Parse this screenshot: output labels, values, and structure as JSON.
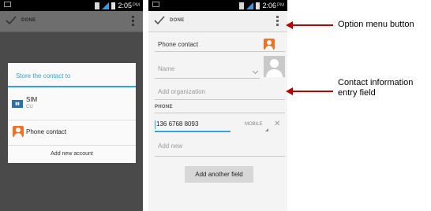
{
  "left_phone": {
    "status": {
      "time": "2:05",
      "ampm": "PM"
    },
    "action": {
      "done_label": "DONE"
    },
    "dialog": {
      "title": "Store the contact to",
      "options": [
        {
          "name": "SIM",
          "sub": "CU",
          "icon": "sim-card-icon"
        },
        {
          "name": "Phone contact",
          "icon": "contact-icon"
        }
      ],
      "add_account": "Add new account"
    }
  },
  "right_phone": {
    "status": {
      "time": "2:06",
      "ampm": "PM"
    },
    "action": {
      "done_label": "DONE"
    },
    "account_label": "Phone contact",
    "name_placeholder": "Name",
    "org_placeholder": "Add organization",
    "phone_section": "PHONE",
    "phone_value": "136 6768 8093",
    "phone_type": "MOBILE",
    "add_new": "Add new",
    "add_field_button": "Add another field"
  },
  "annotations": {
    "option_menu": "Option menu button",
    "contact_entry_line1": "Contact information",
    "contact_entry_line2": "entry field"
  },
  "colors": {
    "accent": "#33a3d8",
    "contact_orange": "#f2701f",
    "arrow_red": "#c00000"
  }
}
